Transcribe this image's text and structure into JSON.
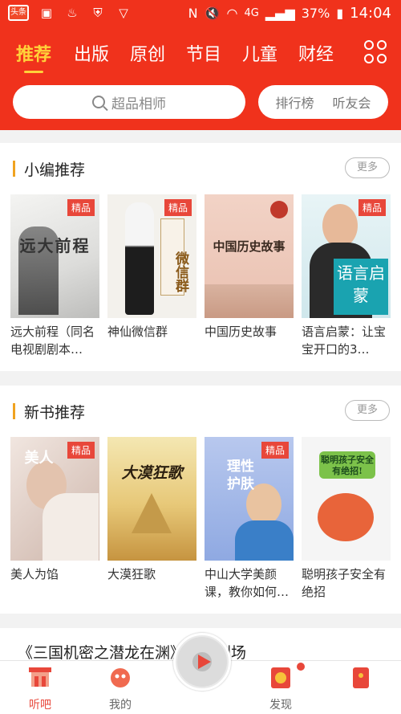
{
  "status_bar": {
    "app_badge": "头条",
    "network": "4G",
    "battery": "37%",
    "time": "14:04"
  },
  "tabs": [
    {
      "label": "推荐",
      "active": true
    },
    {
      "label": "出版",
      "active": false
    },
    {
      "label": "原创",
      "active": false
    },
    {
      "label": "节目",
      "active": false
    },
    {
      "label": "儿童",
      "active": false
    },
    {
      "label": "财经",
      "active": false
    }
  ],
  "search": {
    "placeholder": "超品相师",
    "ranking_label": "排行榜",
    "friends_label": "听友会"
  },
  "sections": [
    {
      "title": "小编推荐",
      "more_label": "更多",
      "books": [
        {
          "title": "远大前程（同名电视剧剧本…",
          "badge": "精品",
          "cover_text": "远大前程"
        },
        {
          "title": "神仙微信群",
          "badge": "精品",
          "cover_text": "微信群"
        },
        {
          "title": "中国历史故事",
          "badge": "",
          "cover_text": "中国历史故事"
        },
        {
          "title": "语言启蒙：让宝宝开口的3…",
          "badge": "精品",
          "cover_text": "语言启蒙"
        }
      ]
    },
    {
      "title": "新书推荐",
      "more_label": "更多",
      "books": [
        {
          "title": "美人为馅",
          "badge": "精品",
          "cover_text": "美人"
        },
        {
          "title": "大漠狂歌",
          "badge": "",
          "cover_text": "大漠狂歌"
        },
        {
          "title": "中山大学美颜课，教你如何…",
          "badge": "精品",
          "cover_text": "理性护肤"
        },
        {
          "title": "聪明孩子安全有绝招",
          "badge": "",
          "cover_text": "聪明孩子安全有绝招!"
        }
      ]
    }
  ],
  "radio_peek": "《三国机密之潜龙在渊》广播剧场",
  "bottom_nav": [
    {
      "label": "听吧",
      "active": true
    },
    {
      "label": "我的",
      "active": false
    },
    {
      "label": "发现",
      "active": false
    },
    {
      "label": "",
      "active": false
    }
  ],
  "colors": {
    "brand_red": "#f0321c",
    "active_tab": "#ffd23a",
    "section_accent": "#f0a320",
    "badge_red": "#e8473a"
  }
}
